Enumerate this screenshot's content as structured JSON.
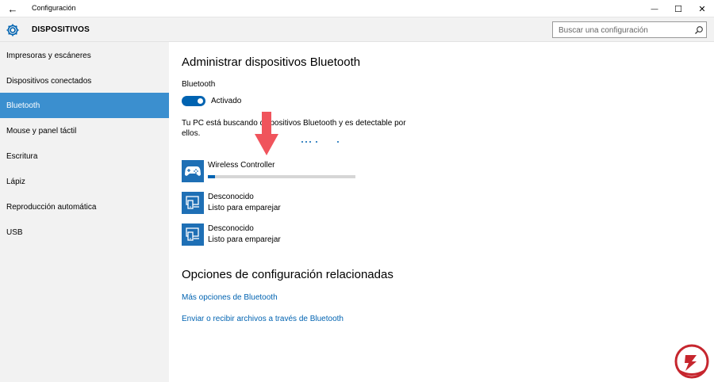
{
  "window": {
    "title": "Configuración",
    "back_glyph": "←",
    "controls": {
      "minimize": "—",
      "maximize": "☐",
      "close": "✕"
    }
  },
  "header": {
    "title": "DISPOSITIVOS",
    "icon": "gear-icon",
    "search_placeholder": "Buscar una configuración"
  },
  "sidebar": {
    "items": [
      {
        "label": "Impresoras y escáneres",
        "active": false
      },
      {
        "label": "Dispositivos conectados",
        "active": false
      },
      {
        "label": "Bluetooth",
        "active": true
      },
      {
        "label": "Mouse y panel táctil",
        "active": false
      },
      {
        "label": "Escritura",
        "active": false
      },
      {
        "label": "Lápiz",
        "active": false
      },
      {
        "label": "Reproducción automática",
        "active": false
      },
      {
        "label": "USB",
        "active": false
      }
    ]
  },
  "main": {
    "heading": "Administrar dispositivos Bluetooth",
    "bluetooth_label": "Bluetooth",
    "toggle_state": "Activado",
    "toggle_on": true,
    "description": "Tu PC está buscando dispositivos Bluetooth y es detectable por ellos.",
    "devices": [
      {
        "name": "Wireless Controller",
        "status": "",
        "icon": "gamepad-icon",
        "pairing_progress": 0.05
      },
      {
        "name": "Desconocido",
        "status": "Listo para emparejar",
        "icon": "device-icon"
      },
      {
        "name": "Desconocido",
        "status": "Listo para emparejar",
        "icon": "device-icon"
      }
    ],
    "related_heading": "Opciones de configuración relacionadas",
    "related_links": [
      "Más opciones de Bluetooth",
      "Enviar o recibir archivos a través de Bluetooth"
    ]
  },
  "colors": {
    "accent": "#0063b1",
    "sidebar_active": "#3b8fcf",
    "device_tile": "#1e6fb5",
    "annotation_arrow": "#f0545c",
    "logo_red": "#c6262e"
  }
}
